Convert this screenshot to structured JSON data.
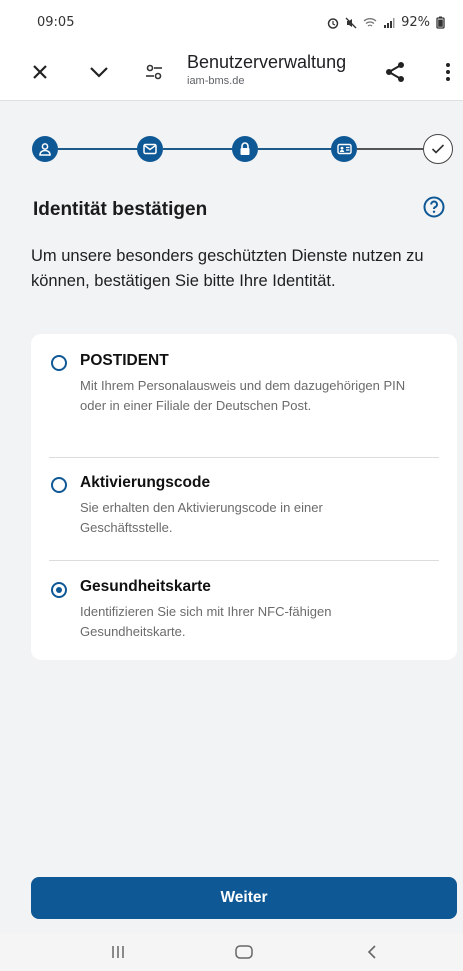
{
  "status_bar": {
    "time": "09:05",
    "battery": "92%"
  },
  "browser": {
    "title": "Benutzerverwaltung",
    "url": "iam-bms.de"
  },
  "stepper": {
    "steps": [
      {
        "icon": "user-icon",
        "state": "active"
      },
      {
        "icon": "mail-icon",
        "state": "active"
      },
      {
        "icon": "lock-icon",
        "state": "active"
      },
      {
        "icon": "id-card-icon",
        "state": "active"
      },
      {
        "icon": "check-icon",
        "state": "done"
      }
    ]
  },
  "page": {
    "heading": "Identität bestätigen",
    "intro": "Um unsere besonders geschützten Dienste nutzen zu können, bestätigen Sie bitte Ihre Identität."
  },
  "options": [
    {
      "title": "POSTIDENT",
      "description": "Mit Ihrem Personalausweis und dem dazugehörigen PIN oder in einer Filiale der Deutschen Post.",
      "selected": false
    },
    {
      "title": "Aktivierungscode",
      "description": "Sie erhalten den Aktivierungscode in einer Geschäftsstelle.",
      "selected": false
    },
    {
      "title": "Gesundheitskarte",
      "description": "Identifizieren Sie sich mit Ihrer NFC-fähigen Gesundheitskarte.",
      "selected": true
    }
  ],
  "actions": {
    "next_label": "Weiter"
  },
  "colors": {
    "primary": "#0f5896",
    "background": "#f1f3f4"
  }
}
